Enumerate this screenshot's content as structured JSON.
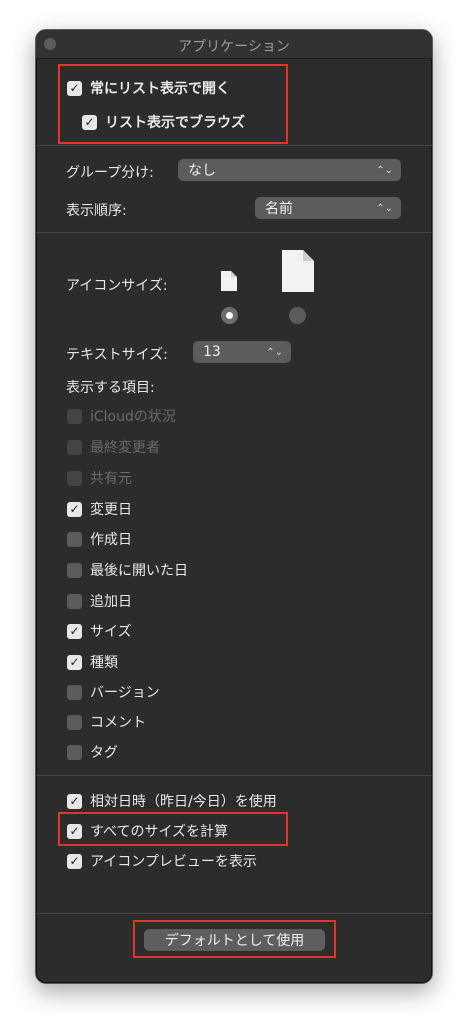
{
  "window": {
    "title": "アプリケーション"
  },
  "top_options": [
    {
      "label": "常にリスト表示で開く",
      "checked": true
    },
    {
      "label": "リスト表示でブラウズ",
      "checked": true
    }
  ],
  "group_by": {
    "label": "グループ分け:",
    "value": "なし"
  },
  "sort_by": {
    "label": "表示順序:",
    "value": "名前"
  },
  "icon_size": {
    "label": "アイコンサイズ:",
    "selected": "small"
  },
  "text_size": {
    "label": "テキストサイズ:",
    "value": "13"
  },
  "columns": {
    "heading": "表示する項目:",
    "items": [
      {
        "label": "iCloudの状況",
        "checked": false,
        "enabled": false
      },
      {
        "label": "最終変更者",
        "checked": false,
        "enabled": false
      },
      {
        "label": "共有元",
        "checked": false,
        "enabled": false
      },
      {
        "label": "変更日",
        "checked": true,
        "enabled": true
      },
      {
        "label": "作成日",
        "checked": false,
        "enabled": true
      },
      {
        "label": "最後に開いた日",
        "checked": false,
        "enabled": true
      },
      {
        "label": "追加日",
        "checked": false,
        "enabled": true
      },
      {
        "label": "サイズ",
        "checked": true,
        "enabled": true
      },
      {
        "label": "種類",
        "checked": true,
        "enabled": true
      },
      {
        "label": "バージョン",
        "checked": false,
        "enabled": true
      },
      {
        "label": "コメント",
        "checked": false,
        "enabled": true
      },
      {
        "label": "タグ",
        "checked": false,
        "enabled": true
      }
    ]
  },
  "bottom_options": [
    {
      "label": "相対日時（昨日/今日）を使用",
      "checked": true
    },
    {
      "label": "すべてのサイズを計算",
      "checked": true
    },
    {
      "label": "アイコンプレビューを表示",
      "checked": true
    }
  ],
  "default_button": {
    "label": "デフォルトとして使用"
  },
  "colors": {
    "highlight": "#e5332a",
    "window_bg": "#2c2c2c"
  }
}
